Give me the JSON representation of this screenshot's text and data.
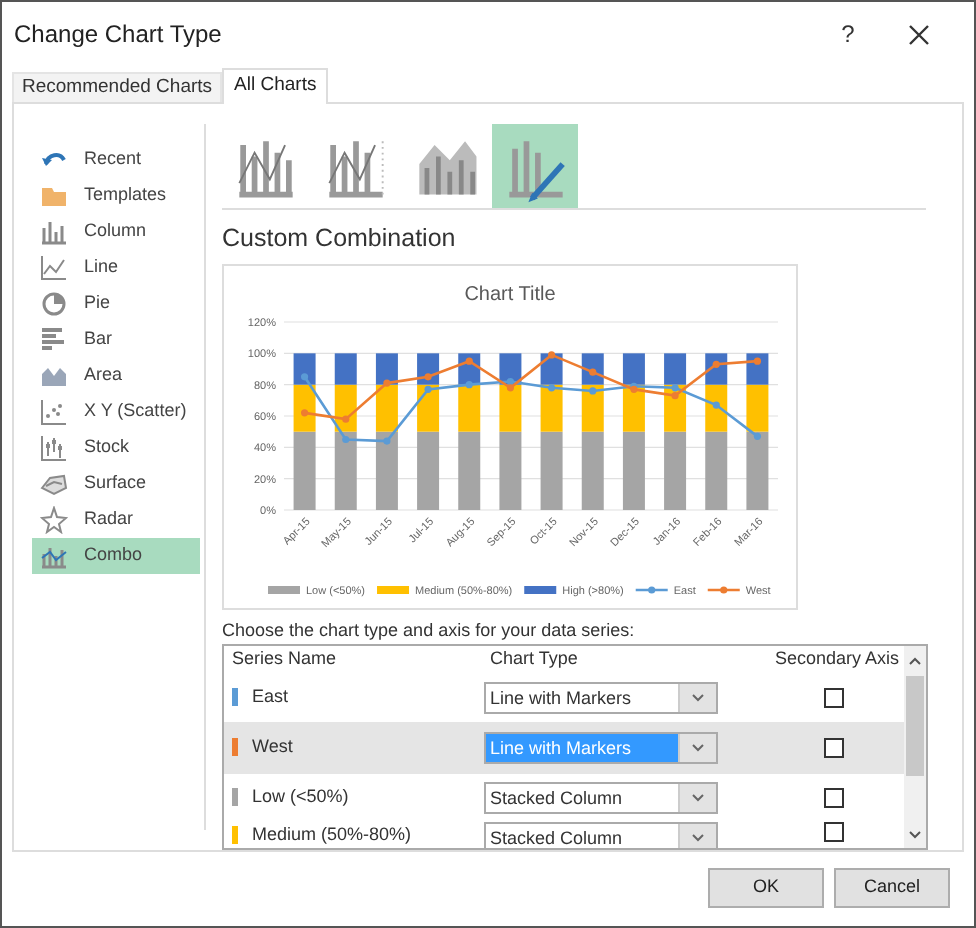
{
  "window": {
    "title": "Change Chart Type",
    "help": "?"
  },
  "tabs": [
    {
      "label": "Recommended Charts",
      "selected": false
    },
    {
      "label": "All Charts",
      "selected": true
    }
  ],
  "sidebar": {
    "items": [
      {
        "label": "Recent",
        "selected": false
      },
      {
        "label": "Templates",
        "selected": false
      },
      {
        "label": "Column",
        "selected": false
      },
      {
        "label": "Line",
        "selected": false
      },
      {
        "label": "Pie",
        "selected": false
      },
      {
        "label": "Bar",
        "selected": false
      },
      {
        "label": "Area",
        "selected": false
      },
      {
        "label": "X Y (Scatter)",
        "selected": false
      },
      {
        "label": "Stock",
        "selected": false
      },
      {
        "label": "Surface",
        "selected": false
      },
      {
        "label": "Radar",
        "selected": false
      },
      {
        "label": "Combo",
        "selected": true
      }
    ]
  },
  "chart_subtypes": [
    {
      "selected": false
    },
    {
      "selected": false
    },
    {
      "selected": false
    },
    {
      "selected": true
    }
  ],
  "heading": "Custom Combination",
  "preview": {
    "chart_data": {
      "type": "bar",
      "title": "Chart Title",
      "stacked": true,
      "grid": true,
      "legend": true,
      "categories": [
        "Apr-15",
        "May-15",
        "Jun-15",
        "Jul-15",
        "Aug-15",
        "Sep-15",
        "Oct-15",
        "Nov-15",
        "Dec-15",
        "Jan-16",
        "Feb-16",
        "Mar-16"
      ],
      "ylim": [
        0,
        1.2
      ],
      "yticks": [
        {
          "value": 0,
          "label": "0%"
        },
        {
          "value": 0.2,
          "label": "20%"
        },
        {
          "value": 0.4,
          "label": "40%"
        },
        {
          "value": 0.6,
          "label": "60%"
        },
        {
          "value": 0.8,
          "label": "80%"
        },
        {
          "value": 1,
          "label": "100%"
        },
        {
          "value": 1.2,
          "label": "120%"
        }
      ],
      "series": [
        {
          "name": "Low (<50%)",
          "type": "bar",
          "color": "#a5a5a5",
          "values": [
            0.5,
            0.5,
            0.5,
            0.5,
            0.5,
            0.5,
            0.5,
            0.5,
            0.5,
            0.5,
            0.5,
            0.5
          ]
        },
        {
          "name": "Medium (50%-80%)",
          "type": "bar",
          "color": "#ffc000",
          "values": [
            0.3,
            0.3,
            0.3,
            0.3,
            0.3,
            0.3,
            0.3,
            0.3,
            0.3,
            0.3,
            0.3,
            0.3
          ]
        },
        {
          "name": "High (>80%)",
          "type": "bar",
          "color": "#4472c4",
          "values": [
            0.2,
            0.2,
            0.2,
            0.2,
            0.2,
            0.2,
            0.2,
            0.2,
            0.2,
            0.2,
            0.2,
            0.2
          ]
        },
        {
          "name": "East",
          "type": "line",
          "marker": "circle",
          "color": "#5b9bd5",
          "values": [
            0.85,
            0.45,
            0.44,
            0.77,
            0.8,
            0.82,
            0.78,
            0.76,
            0.79,
            0.78,
            0.67,
            0.47
          ]
        },
        {
          "name": "West",
          "type": "line",
          "marker": "circle",
          "color": "#ed7d31",
          "values": [
            0.62,
            0.58,
            0.81,
            0.85,
            0.95,
            0.78,
            0.99,
            0.88,
            0.77,
            0.73,
            0.93,
            0.95
          ]
        }
      ]
    }
  },
  "series_table": {
    "instruction": "Choose the chart type and axis for your data series:",
    "columns": [
      "Series Name",
      "Chart Type",
      "Secondary Axis"
    ],
    "rows": [
      {
        "name": "East",
        "color": "#5b9bd5",
        "chart_type": "Line with Markers",
        "secondary_axis": false,
        "selected": false
      },
      {
        "name": "West",
        "color": "#ed7d31",
        "chart_type": "Line with Markers",
        "secondary_axis": false,
        "selected": true
      },
      {
        "name": "Low (<50%)",
        "color": "#a5a5a5",
        "chart_type": "Stacked Column",
        "secondary_axis": false,
        "selected": false
      },
      {
        "name": "Medium (50%-80%)",
        "color": "#ffc000",
        "chart_type": "Stacked Column",
        "secondary_axis": false,
        "selected": false
      }
    ]
  },
  "buttons": [
    "OK",
    "Cancel"
  ]
}
